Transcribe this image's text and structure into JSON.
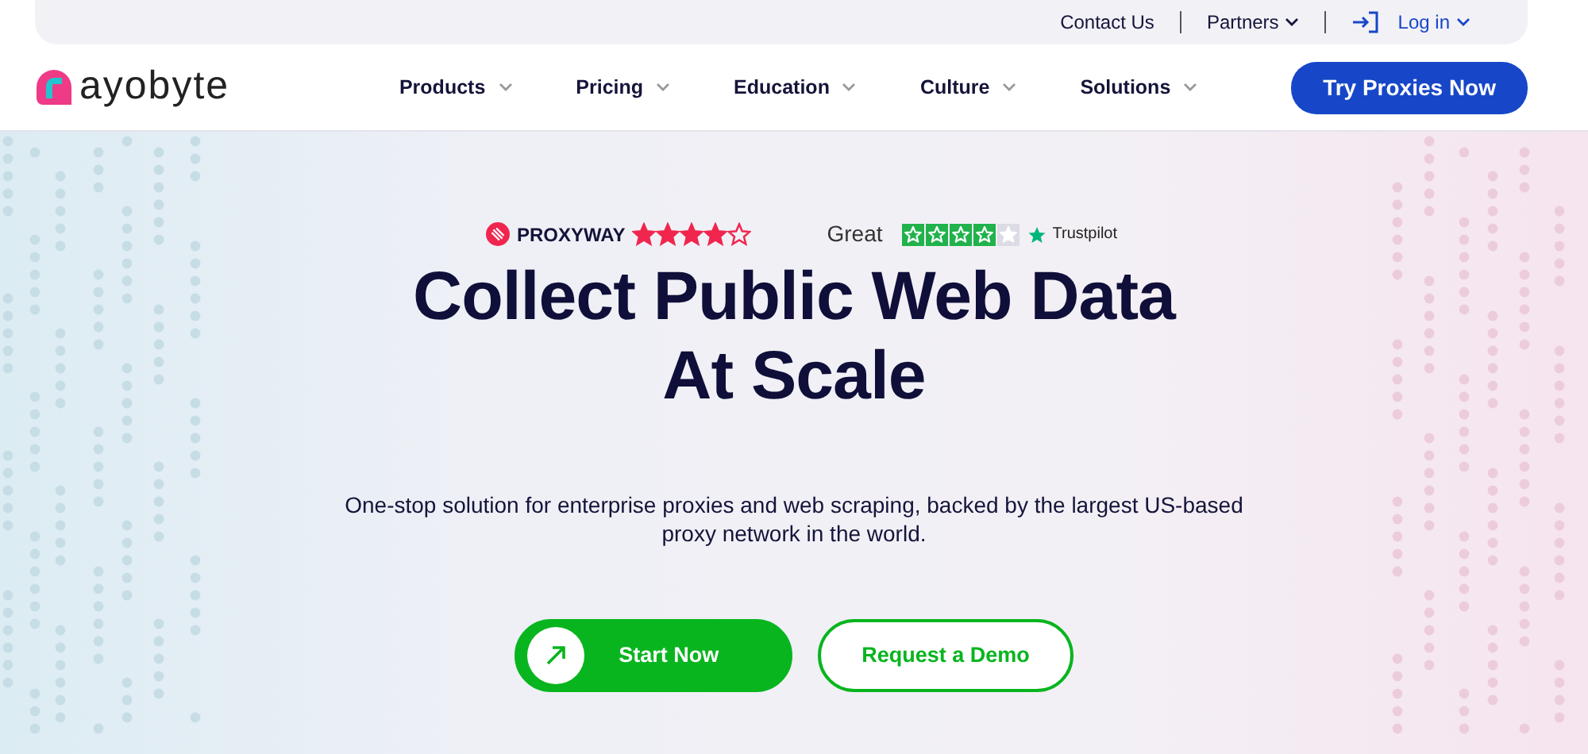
{
  "top_bar": {
    "links": [
      {
        "label": "Contact Us",
        "kind": "plain"
      },
      {
        "label": "Partners",
        "kind": "dropdown"
      },
      {
        "label": "Log in",
        "kind": "login"
      }
    ]
  },
  "navbar": {
    "logo": "ayobyte",
    "menu": [
      "Products",
      "Pricing",
      "Education",
      "Culture",
      "Solutions"
    ],
    "cta": "Try Proxies Now"
  },
  "ratings": [
    {
      "kind": "proxyway",
      "brand": "PROXYWAY",
      "stars": 4
    },
    {
      "kind": "trustpilot",
      "label": "Great",
      "stars": 4,
      "brand": "Trustpilot"
    }
  ],
  "hero": {
    "title_lines": [
      "Collect Public Web Data",
      "At Scale"
    ],
    "subtitle": "One-stop solution for enterprise proxies and web scraping, backed by the largest US-based proxy network in the world."
  },
  "buttons": [
    {
      "label": "Start Now",
      "kind": "primary"
    },
    {
      "label": "Request a Demo",
      "kind": "outline"
    }
  ]
}
